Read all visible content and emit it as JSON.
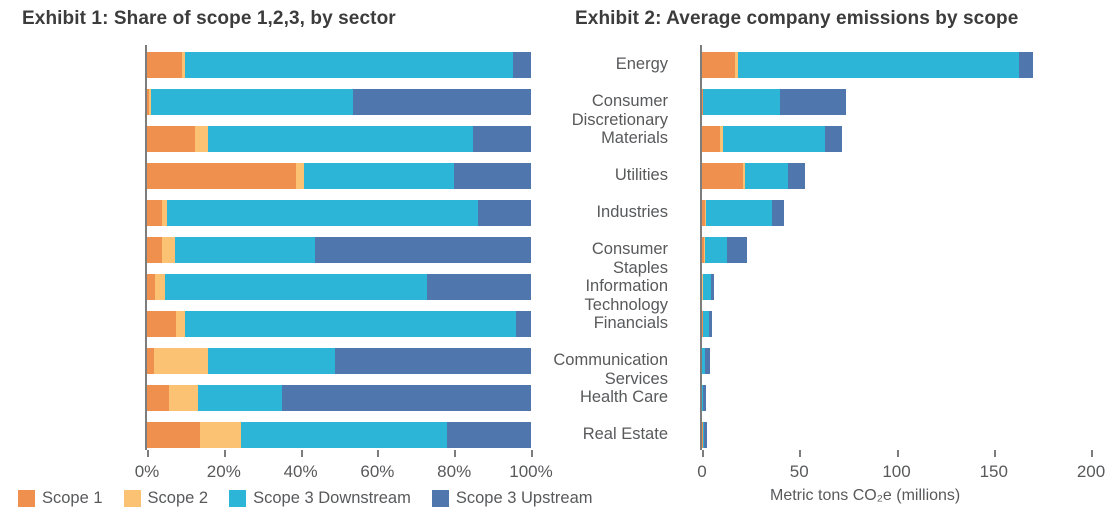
{
  "legend": {
    "items": [
      {
        "label": "Scope 1",
        "color": "#f0904f"
      },
      {
        "label": "Scope 2",
        "color": "#fbc274"
      },
      {
        "label": "Scope 3 Downstream",
        "color": "#2cb5d6"
      },
      {
        "label": "Scope 3 Upstream",
        "color": "#4f76ad"
      }
    ]
  },
  "chart_data": [
    {
      "type": "bar",
      "orientation": "horizontal",
      "stacked": true,
      "normalized": true,
      "title": "Exhibit 1: Share of scope 1,2,3, by sector",
      "xlabel": "",
      "ylabel": "",
      "xlim": [
        0,
        100
      ],
      "xticks": [
        0,
        20,
        40,
        60,
        80,
        100
      ],
      "xtick_labels": [
        "0%",
        "20%",
        "40%",
        "60%",
        "80%",
        "100%"
      ],
      "grid": false,
      "legend_position": "bottom-left",
      "categories": [
        "Energy",
        "Consumer\nDiscretionary",
        "Materials",
        "Utilities",
        "Industries",
        "Consumer\nStaples",
        "Information\nTechnology",
        "Financials",
        "Communication\nServices",
        "Health Care",
        "Real Estate"
      ],
      "series": [
        {
          "name": "Scope 1",
          "color": "#f0904f",
          "values": [
            9.0,
            0.6,
            12.5,
            38.8,
            4.0,
            4.0,
            2.0,
            7.5,
            1.8,
            5.7,
            13.8
          ]
        },
        {
          "name": "Scope 2",
          "color": "#fbc274",
          "values": [
            1.0,
            0.5,
            3.4,
            2.2,
            1.2,
            3.2,
            2.8,
            2.3,
            14.2,
            7.5,
            10.8
          ]
        },
        {
          "name": "Scope 3 Downstream",
          "color": "#2cb5d6",
          "values": [
            85.2,
            52.6,
            69.1,
            39.0,
            81.0,
            36.6,
            68.1,
            86.2,
            33.0,
            22.0,
            53.6
          ]
        },
        {
          "name": "Scope 3 Upstream",
          "color": "#4f76ad",
          "values": [
            4.8,
            46.3,
            15.0,
            20.0,
            13.8,
            56.2,
            27.1,
            4.0,
            51.0,
            64.8,
            21.8
          ]
        }
      ]
    },
    {
      "type": "bar",
      "orientation": "horizontal",
      "stacked": true,
      "normalized": false,
      "title": "Exhibit 2: Average company emissions by scope",
      "xlabel": "Metric tons CO₂e  (millions)",
      "ylabel": "",
      "xlim": [
        0,
        200
      ],
      "xticks": [
        0,
        50,
        100,
        150,
        200
      ],
      "xtick_labels": [
        "0",
        "50",
        "100",
        "150",
        "200"
      ],
      "grid": false,
      "legend_position": "bottom-left",
      "categories": [
        "Energy",
        "Consumer\nDiscretionary",
        "Materials",
        "Utilities",
        "Industries",
        "Consumer\nStaples",
        "Information\nTechnology",
        "Financials",
        "Communication\nServices",
        "Health Care",
        "Real Estate"
      ],
      "series": [
        {
          "name": "Scope 1",
          "color": "#f0904f",
          "values": [
            17.0,
            0.4,
            9.2,
            21.0,
            1.6,
            0.8,
            0.1,
            0.3,
            0.1,
            0.1,
            0.3
          ]
        },
        {
          "name": "Scope 2",
          "color": "#fbc274",
          "values": [
            1.6,
            0.3,
            1.4,
            1.2,
            0.5,
            0.6,
            0.2,
            0.1,
            0.1,
            0.1,
            0.2
          ]
        },
        {
          "name": "Scope 3 Downstream",
          "color": "#2cb5d6",
          "values": [
            144.4,
            39.3,
            52.4,
            21.8,
            33.9,
            11.6,
            4.1,
            3.2,
            1.4,
            0.5,
            0.6
          ]
        },
        {
          "name": "Scope 3 Upstream",
          "color": "#4f76ad",
          "values": [
            7.0,
            34.0,
            9.0,
            9.0,
            6.0,
            10.0,
            1.6,
            1.4,
            2.4,
            1.3,
            1.4
          ]
        }
      ]
    }
  ]
}
